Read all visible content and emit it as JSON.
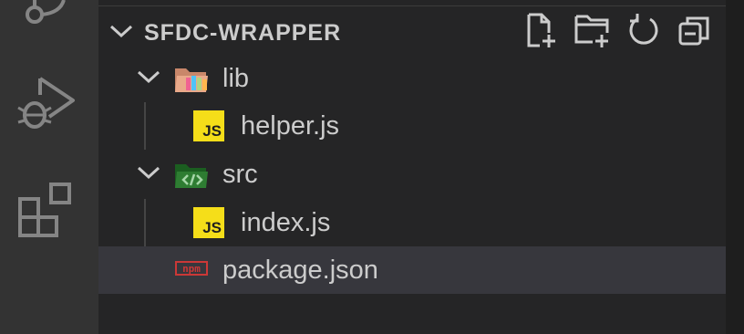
{
  "activity_bar": {
    "icons": [
      "source-control-icon",
      "run-debug-icon",
      "extensions-icon"
    ]
  },
  "explorer": {
    "section_title": "SFDC-WRAPPER",
    "actions": [
      "new-file-icon",
      "new-folder-icon",
      "refresh-icon",
      "collapse-all-icon"
    ],
    "tree": [
      {
        "label": "lib",
        "type": "folder",
        "expanded": true
      },
      {
        "label": "helper.js",
        "type": "js-file"
      },
      {
        "label": "src",
        "type": "folder",
        "expanded": true
      },
      {
        "label": "index.js",
        "type": "js-file"
      },
      {
        "label": "package.json",
        "type": "npm-file",
        "selected": true
      }
    ],
    "js_badge": "JS",
    "npm_badge": "npm"
  },
  "colors": {
    "activity_bar": "#333333",
    "sidebar": "#252526",
    "selected_row": "#37373d",
    "text": "#cccccc",
    "js_yellow": "#f5de19",
    "npm_red": "#cb3837",
    "src_green": "#2e7d32"
  }
}
